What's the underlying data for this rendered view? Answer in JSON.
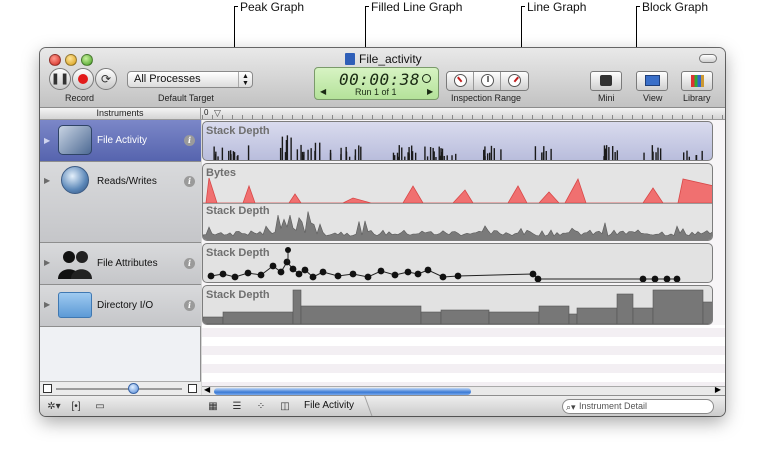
{
  "callouts": {
    "peak_graph": "Peak Graph",
    "filled_line_graph": "Filled Line Graph",
    "line_graph": "Line Graph",
    "block_graph": "Block Graph"
  },
  "window": {
    "title": "File_activity"
  },
  "toolbar": {
    "record_label": "Record",
    "process_select": "All Processes",
    "default_target_label": "Default Target",
    "time": "00:00:38",
    "run": "Run 1 of 1",
    "inspection_range_label": "Inspection Range",
    "mini_label": "Mini",
    "view_label": "View",
    "library_label": "Library"
  },
  "instruments_header": "Instruments",
  "ruler_zero": "0",
  "instruments": [
    {
      "name": "File Activity",
      "icon": "hard-drive-icon",
      "selected": true
    },
    {
      "name": "Reads/Writes",
      "icon": "globe-disk-icon",
      "selected": false
    },
    {
      "name": "File Attributes",
      "icon": "people-icon",
      "selected": false
    },
    {
      "name": "Directory I/O",
      "icon": "folder-icon",
      "selected": false
    }
  ],
  "tracks": {
    "file_activity": "Stack Depth",
    "reads_writes_bytes": "Bytes",
    "reads_writes_stack": "Stack Depth",
    "file_attributes": "Stack Depth",
    "directory_io": "Stack Depth"
  },
  "bottom": {
    "breadcrumb": "File Activity",
    "search_placeholder": "Instrument Detail"
  },
  "colors": {
    "selected_row": "#5f6cb6",
    "bytes_fill": "#f07070",
    "record_red": "#e21a1a",
    "lcd_green": "#c2e8a8"
  }
}
